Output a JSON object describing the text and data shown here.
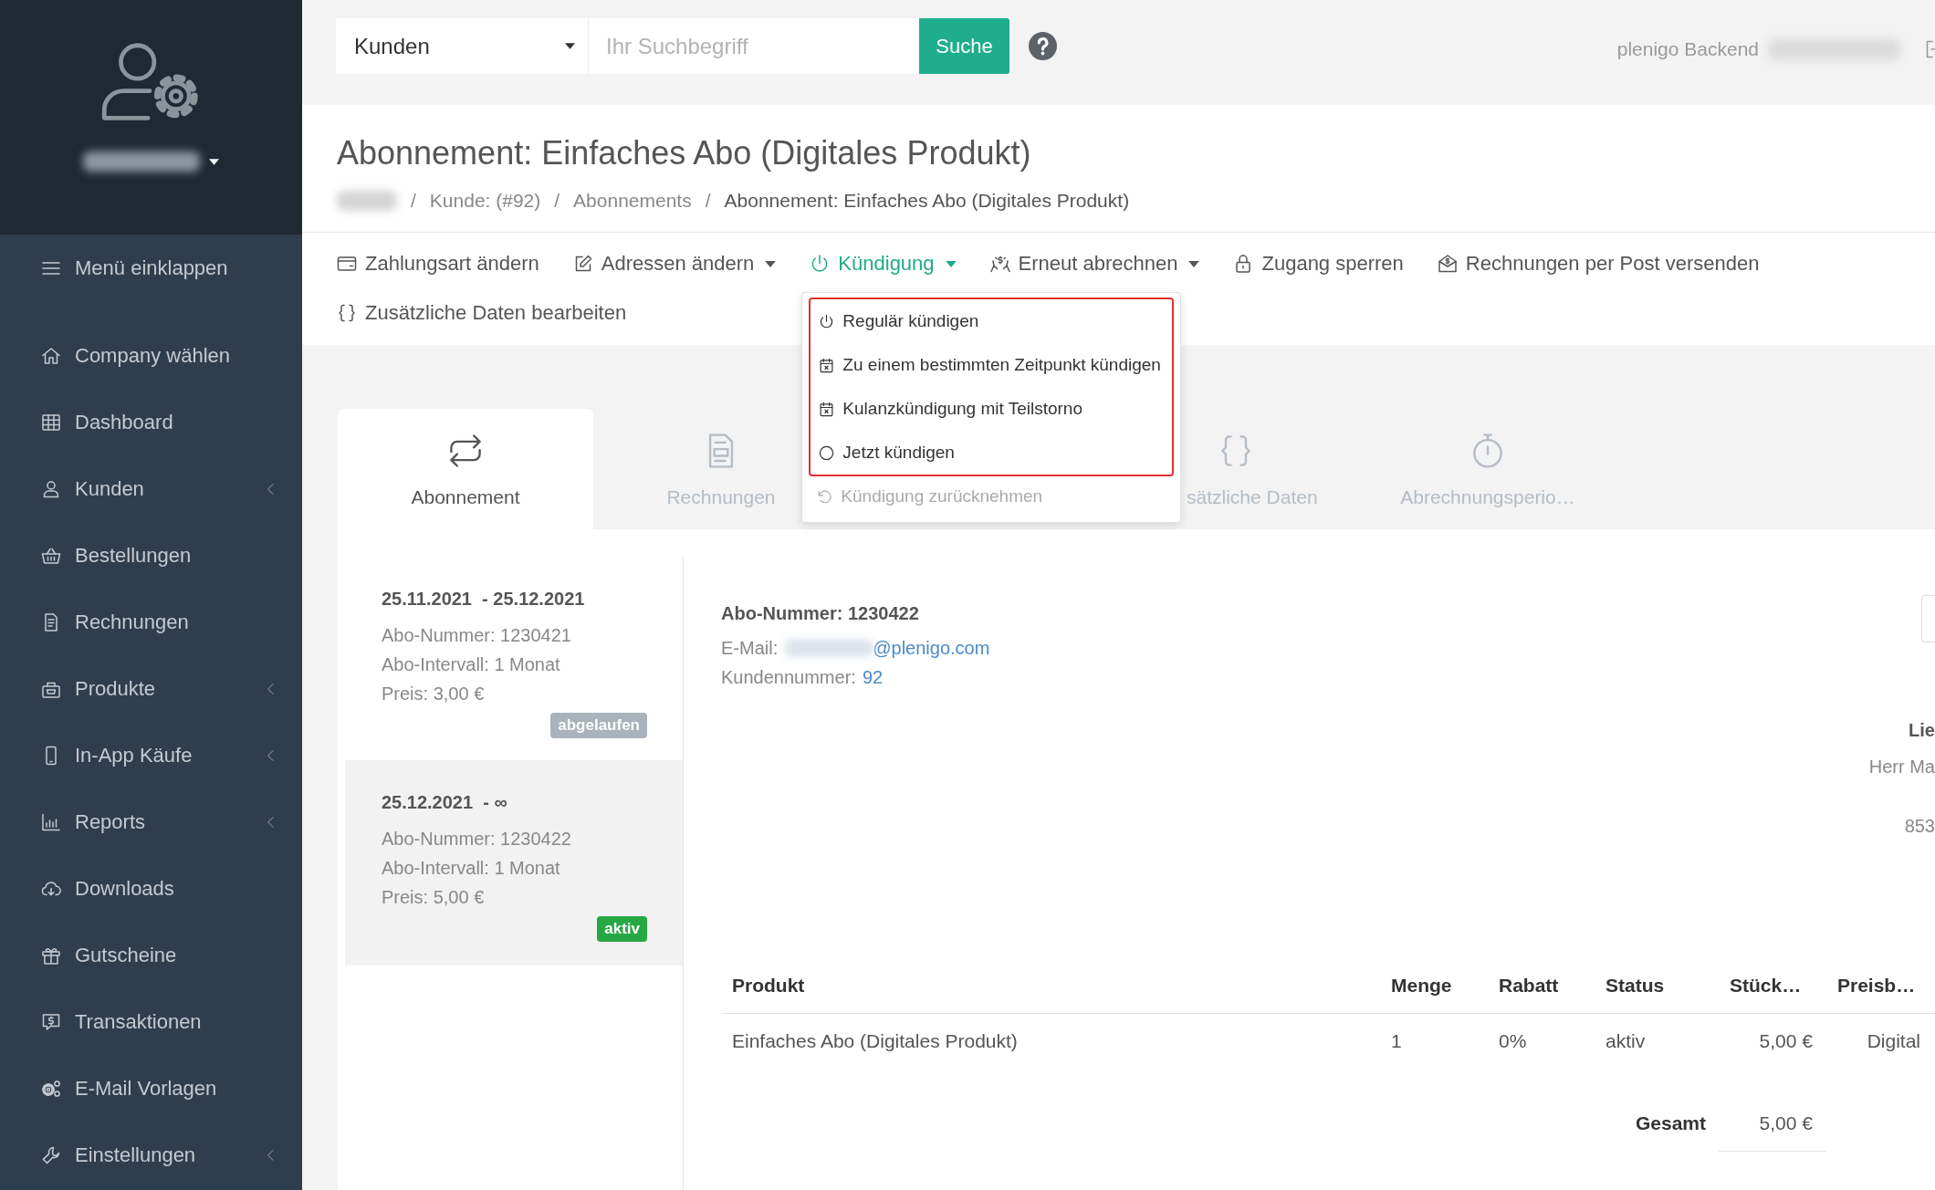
{
  "sidebar": {
    "collapse_label": "Menü einklappen",
    "items": [
      {
        "label": "Company wählen",
        "submenu": false
      },
      {
        "label": "Dashboard",
        "submenu": false
      },
      {
        "label": "Kunden",
        "submenu": true
      },
      {
        "label": "Bestellungen",
        "submenu": false
      },
      {
        "label": "Rechnungen",
        "submenu": false
      },
      {
        "label": "Produkte",
        "submenu": true
      },
      {
        "label": "In-App Käufe",
        "submenu": true
      },
      {
        "label": "Reports",
        "submenu": true
      },
      {
        "label": "Downloads",
        "submenu": false
      },
      {
        "label": "Gutscheine",
        "submenu": false
      },
      {
        "label": "Transaktionen",
        "submenu": false
      },
      {
        "label": "E-Mail Vorlagen",
        "submenu": false
      },
      {
        "label": "Einstellungen",
        "submenu": true
      }
    ]
  },
  "search": {
    "scope": "Kunden",
    "placeholder": "Ihr Suchbegriff",
    "button": "Suche"
  },
  "account": {
    "label": "plenigo Backend"
  },
  "page": {
    "title": "Abonnement: Einfaches Abo (Digitales Produkt)",
    "breadcrumb": {
      "separator": "/",
      "items": [
        {
          "label": "Kunde: (#92)",
          "current": false
        },
        {
          "label": "Abonnements",
          "current": false
        },
        {
          "label": "Abonnement: Einfaches Abo (Digitales Produkt)",
          "current": true
        }
      ]
    }
  },
  "toolbar": [
    {
      "label": "Zahlungsart ändern",
      "caret": false,
      "expanded": false
    },
    {
      "label": "Adressen ändern",
      "caret": true,
      "expanded": false
    },
    {
      "label": "Kündigung",
      "caret": true,
      "expanded": true
    },
    {
      "label": "Erneut abrechnen",
      "caret": true,
      "expanded": false
    },
    {
      "label": "Zugang sperren",
      "caret": false,
      "expanded": false
    },
    {
      "label": "Rechnungen per Post versenden",
      "caret": false,
      "expanded": false
    },
    {
      "label": "Zusätzliche Daten bearbeiten",
      "caret": false,
      "expanded": false
    }
  ],
  "dropdown": {
    "items": [
      {
        "label": "Regulär kündigen",
        "disabled": false,
        "highlighted": true
      },
      {
        "label": "Zu einem bestimmten Zeitpunkt kündigen",
        "disabled": false,
        "highlighted": true
      },
      {
        "label": "Kulanzkündigung mit Teilstorno",
        "disabled": false,
        "highlighted": true
      },
      {
        "label": "Jetzt kündigen",
        "disabled": false,
        "highlighted": true
      },
      {
        "label": "Kündigung zurücknehmen",
        "disabled": true,
        "highlighted": false
      }
    ]
  },
  "tabs": [
    {
      "label": "Abonnement",
      "selected": true
    },
    {
      "label": "Rechnungen",
      "selected": false
    },
    {
      "label": "sätzliche Daten",
      "selected": false
    },
    {
      "label": "Abrechnungsperio…",
      "selected": false
    }
  ],
  "subscriptions": [
    {
      "period": "25.11.2021  - 25.12.2021",
      "lines": [
        "Abo-Nummer: 1230421",
        "Abo-Intervall: 1 Monat",
        "Preis: 3,00 €"
      ],
      "badge": {
        "text": "abgelaufen",
        "color": "#aab2bb"
      },
      "selected": false
    },
    {
      "period": "25.12.2021  - ∞",
      "lines": [
        "Abo-Nummer: 1230422",
        "Abo-Intervall: 1 Monat",
        "Preis: 5,00 €"
      ],
      "badge": {
        "text": "aktiv",
        "color": "#28a745"
      },
      "selected": true
    }
  ],
  "detail": {
    "title": "Abo-Nummer: 1230422",
    "email_label": "E-Mail:",
    "email_domain": "@plenigo.com",
    "customer_label": "Kundennummer:",
    "customer_number": "92",
    "address": {
      "heading": "Lie",
      "lines": [
        "Herr Ma",
        "853"
      ]
    }
  },
  "table": {
    "columns": [
      "Produkt",
      "Menge",
      "Rabatt",
      "Status",
      "Stück…",
      "Preisb…"
    ],
    "rows": [
      [
        "Einfaches Abo (Digitales Produkt)",
        "1",
        "0%",
        "aktiv",
        "5,00 €",
        "Digital"
      ]
    ],
    "total_label": "Gesamt",
    "total_value": "5,00 €"
  }
}
